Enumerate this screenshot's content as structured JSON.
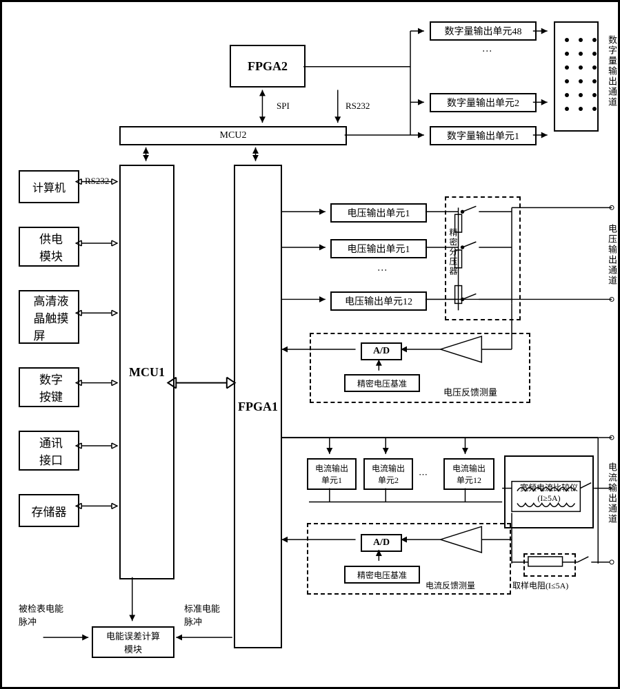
{
  "fpga2": "FPGA2",
  "mcu2": "MCU2",
  "spi": "SPI",
  "rs232_a": "RS232",
  "rs232_b": "RS232",
  "digital_out_48": "数字量输出单元48",
  "digital_out_2": "数字量输出单元2",
  "digital_out_1": "数字量输出单元1",
  "digital_out_channel": "数字量输出通道",
  "computer": "计算机",
  "power_module": "供电\n模块",
  "lcd_touch": "高清液\n晶触摸\n屏",
  "keypad": "数字\n按键",
  "comm_interface": "通讯\n接口",
  "memory": "存储器",
  "mcu1": "MCU1",
  "fpga1": "FPGA1",
  "volt_out_1a": "电压输出单元1",
  "volt_out_1b": "电压输出单元1",
  "volt_out_12": "电压输出单元12",
  "precision_divider": "精密分压器",
  "ad1": "A/D",
  "precision_vref1": "精密电压基准",
  "volt_feedback": "电压反馈测量",
  "volt_out_channel": "电压输出通道",
  "current_out_1": "电流输出\n单元1",
  "current_out_2": "电流输出\n单元2",
  "current_out_12": "电流输出\n单元12",
  "broadband_comparator": "宽频电流比较仪\n(I≥5A)",
  "ad2": "A/D",
  "precision_vref2": "精密电压基准",
  "current_feedback": "电流反馈测量",
  "sample_resistor": "取样电阻(I≤5A)",
  "current_out_channel": "电流输出通道",
  "energy_error": "电能误差计算\n模块",
  "tested_pulse": "被检表电能\n脉冲",
  "standard_pulse": "标准电能\n脉冲"
}
